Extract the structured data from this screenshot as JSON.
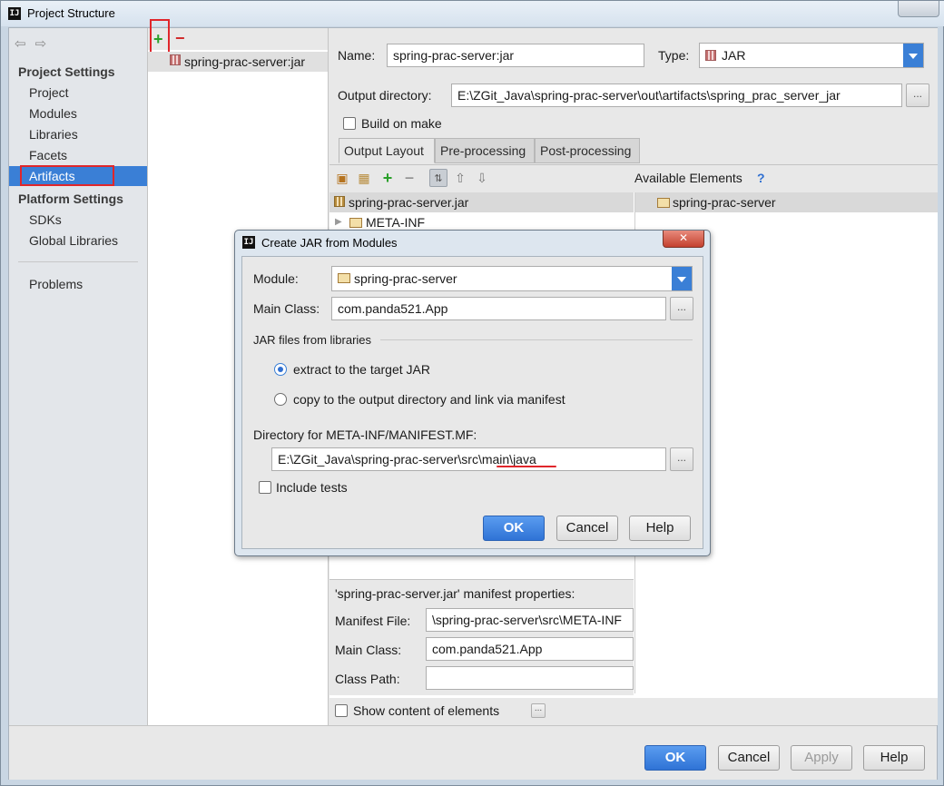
{
  "window": {
    "title": "Project Structure"
  },
  "sidebar": {
    "project_settings_heading": "Project Settings",
    "project_items": [
      {
        "label": "Project"
      },
      {
        "label": "Modules"
      },
      {
        "label": "Libraries"
      },
      {
        "label": "Facets"
      },
      {
        "label": "Artifacts"
      }
    ],
    "platform_settings_heading": "Platform Settings",
    "platform_items": [
      {
        "label": "SDKs"
      },
      {
        "label": "Global Libraries"
      }
    ],
    "problems": "Problems",
    "selected": "Artifacts"
  },
  "artifacts_list": {
    "items": [
      {
        "label": "spring-prac-server:jar"
      }
    ]
  },
  "artifact": {
    "name_label": "Name:",
    "name_value": "spring-prac-server:jar",
    "type_label": "Type:",
    "type_value": "JAR",
    "output_dir_label": "Output directory:",
    "output_dir_value": "E:\\ZGit_Java\\spring-prac-server\\out\\artifacts\\spring_prac_server_jar",
    "build_on_make": "Build on make",
    "tabs": [
      {
        "label": "Output Layout",
        "active": true
      },
      {
        "label": "Pre-processing"
      },
      {
        "label": "Post-processing"
      }
    ],
    "available_elements": "Available Elements",
    "help_mark": "?",
    "layout_tree": [
      {
        "label": "spring-prac-server.jar"
      },
      {
        "label": "META-INF"
      }
    ],
    "available_tree": [
      {
        "label": "spring-prac-server"
      }
    ],
    "manifest": {
      "heading": "'spring-prac-server.jar' manifest properties:",
      "file_label": "Manifest File:",
      "file_value": "\\spring-prac-server\\src\\META-INF",
      "main_class_label": "Main Class:",
      "main_class_value": "com.panda521.App",
      "class_path_label": "Class Path:",
      "class_path_value": ""
    },
    "show_content": "Show content of elements"
  },
  "footer_buttons": {
    "ok": "OK",
    "cancel": "Cancel",
    "apply": "Apply",
    "help": "Help"
  },
  "dialog": {
    "title": "Create JAR from Modules",
    "module_label": "Module:",
    "module_value": "spring-prac-server",
    "main_class_label": "Main Class:",
    "main_class_value": "com.panda521.App",
    "jar_files_heading": "JAR files from libraries",
    "radio_extract": "extract to the target JAR",
    "radio_copy": "copy to the output directory and link via manifest",
    "selected_radio": "extract",
    "manifest_dir_label": "Directory for META-INF/MANIFEST.MF:",
    "manifest_dir_value": "E:\\ZGit_Java\\spring-prac-server\\src\\main\\java",
    "include_tests": "Include tests",
    "ok": "OK",
    "cancel": "Cancel",
    "help": "Help"
  },
  "colors": {
    "selection": "#3a7fd6",
    "highlight_box": "#e0262b",
    "add": "#2aa02a",
    "remove": "#d12b2b"
  }
}
